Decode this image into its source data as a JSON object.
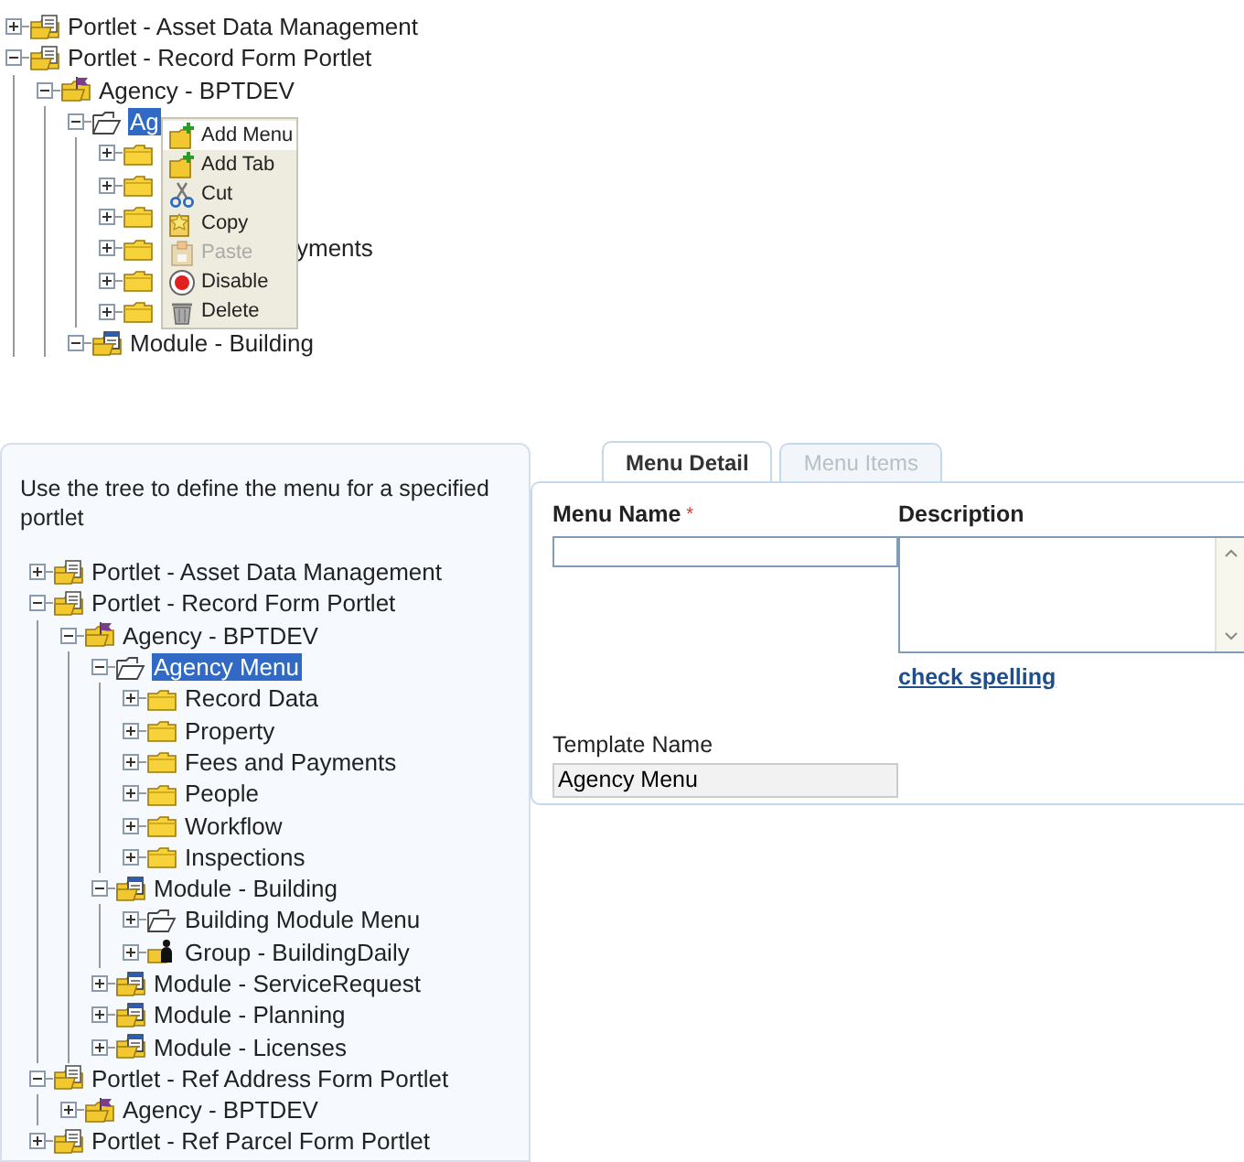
{
  "menu_preview": {
    "tree": [
      {
        "label": "Portlet - Asset Data Management",
        "kind": "portlet",
        "expanded": false,
        "selected": false
      },
      {
        "label": "Portlet - Record Form Portlet",
        "kind": "portlet",
        "expanded": true,
        "selected": false,
        "children": [
          {
            "label": "Agency - BPTDEV",
            "kind": "agency",
            "expanded": true,
            "selected": false,
            "children": [
              {
                "label": "Ag",
                "kind": "menu",
                "expanded": true,
                "selected": true,
                "children": [
                  {
                    "kind": "folder",
                    "expanded": false,
                    "selected": false
                  },
                  {
                    "kind": "folder",
                    "expanded": false,
                    "selected": false
                  },
                  {
                    "kind": "folder",
                    "expanded": false,
                    "selected": false
                  },
                  {
                    "label": "yments",
                    "kind": "folder",
                    "expanded": false,
                    "selected": false,
                    "covered": true
                  },
                  {
                    "kind": "folder",
                    "expanded": false,
                    "selected": false
                  },
                  {
                    "kind": "folder",
                    "expanded": false,
                    "selected": false
                  }
                ]
              },
              {
                "label": "Module - Building",
                "kind": "module",
                "expanded": true,
                "selected": false
              }
            ]
          }
        ]
      }
    ],
    "context_menu": [
      {
        "label": "Add Menu",
        "kind": "add-menu",
        "selected": true,
        "disabled": false
      },
      {
        "label": "Add Tab",
        "kind": "add-tab",
        "selected": false,
        "disabled": false
      },
      {
        "label": "Cut",
        "kind": "cut",
        "selected": false,
        "disabled": false
      },
      {
        "label": "Copy",
        "kind": "copy",
        "selected": false,
        "disabled": false
      },
      {
        "label": "Paste",
        "kind": "paste",
        "selected": false,
        "disabled": true
      },
      {
        "label": "Disable",
        "kind": "disable",
        "selected": false,
        "disabled": false
      },
      {
        "label": "Delete",
        "kind": "delete",
        "selected": false,
        "disabled": false
      }
    ]
  },
  "sidebar": {
    "instructions": "Use the tree to define the menu for a specified portlet",
    "tree": [
      {
        "label": "Portlet - Asset Data Management",
        "kind": "portlet",
        "expanded": false,
        "selected": false
      },
      {
        "label": "Portlet - Record Form Portlet",
        "kind": "portlet",
        "expanded": true,
        "selected": false,
        "children": [
          {
            "label": "Agency - BPTDEV",
            "kind": "agency",
            "expanded": true,
            "selected": false,
            "children": [
              {
                "label": "Agency Menu",
                "kind": "menu",
                "expanded": true,
                "selected": true,
                "children": [
                  {
                    "label": "Record Data",
                    "kind": "folder",
                    "expanded": false,
                    "selected": false
                  },
                  {
                    "label": "Property",
                    "kind": "folder",
                    "expanded": false,
                    "selected": false
                  },
                  {
                    "label": "Fees and Payments",
                    "kind": "folder",
                    "expanded": false,
                    "selected": false
                  },
                  {
                    "label": "People",
                    "kind": "folder",
                    "expanded": false,
                    "selected": false
                  },
                  {
                    "label": "Workflow",
                    "kind": "folder",
                    "expanded": false,
                    "selected": false
                  },
                  {
                    "label": "Inspections",
                    "kind": "folder",
                    "expanded": false,
                    "selected": false
                  }
                ]
              },
              {
                "label": "Module - Building",
                "kind": "module",
                "expanded": true,
                "selected": false,
                "children": [
                  {
                    "label": "Building Module Menu",
                    "kind": "menu",
                    "expanded": false,
                    "selected": false
                  },
                  {
                    "label": "Group - BuildingDaily",
                    "kind": "group",
                    "expanded": false,
                    "selected": false
                  }
                ]
              },
              {
                "label": "Module - ServiceRequest",
                "kind": "module",
                "expanded": false,
                "selected": false
              },
              {
                "label": "Module - Planning",
                "kind": "module",
                "expanded": false,
                "selected": false
              },
              {
                "label": "Module - Licenses",
                "kind": "module",
                "expanded": false,
                "selected": false
              }
            ]
          }
        ]
      },
      {
        "label": "Portlet - Ref Address Form Portlet",
        "kind": "portlet",
        "expanded": true,
        "selected": false,
        "children": [
          {
            "label": "Agency - BPTDEV",
            "kind": "agency",
            "expanded": false,
            "selected": false
          }
        ]
      },
      {
        "label": "Portlet - Ref Parcel Form Portlet",
        "kind": "portlet",
        "expanded": false,
        "selected": false
      }
    ]
  },
  "tabs": [
    {
      "label": "Menu Detail",
      "selected": true,
      "disabled": false
    },
    {
      "label": "Menu Items",
      "selected": false,
      "disabled": true
    }
  ],
  "form": {
    "menu_name": {
      "label": "Menu Name",
      "required_mark": "*"
    },
    "description": {
      "label": "Description"
    },
    "check_spelling": "check spelling",
    "template_name": {
      "label": "Template Name",
      "value": "Agency Menu",
      "readonly": true
    }
  }
}
